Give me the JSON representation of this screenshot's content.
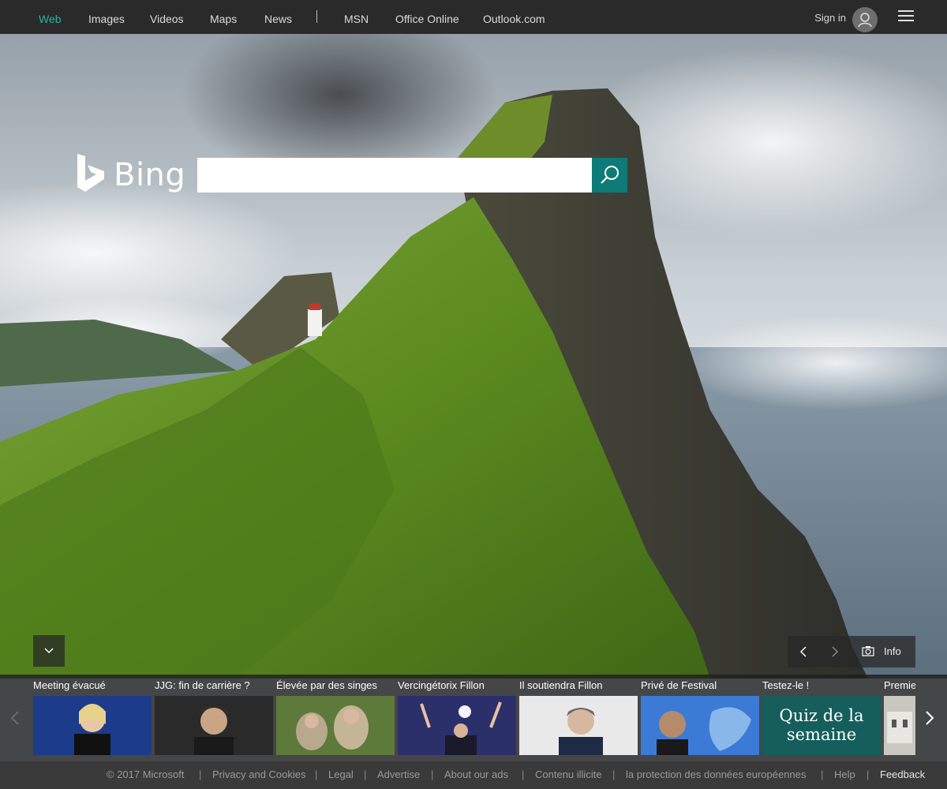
{
  "nav": {
    "items": [
      {
        "label": "Web",
        "active": true
      },
      {
        "label": "Images"
      },
      {
        "label": "Videos"
      },
      {
        "label": "Maps"
      },
      {
        "label": "News"
      },
      {
        "label": "MSN"
      },
      {
        "label": "Office Online"
      },
      {
        "label": "Outlook.com"
      }
    ],
    "sign_in": "Sign in",
    "avatar_icon": "user-icon",
    "menu_icon": "hamburger-icon"
  },
  "logo": {
    "text": "Bing",
    "icon": "bing-logo-icon"
  },
  "search": {
    "value": "",
    "placeholder": "",
    "button_icon": "search-icon"
  },
  "controls": {
    "collapse_icon": "chevron-down-icon",
    "prev_icon": "chevron-left-icon",
    "next_icon": "chevron-right-icon",
    "camera_icon": "camera-icon",
    "info_label": "Info"
  },
  "news": {
    "left_icon": "chevron-left-icon",
    "right_icon": "chevron-right-icon",
    "tiles": [
      {
        "caption": "Meeting évacué"
      },
      {
        "caption": "JJG: fin de carrière ?"
      },
      {
        "caption": "Élevée par des singes"
      },
      {
        "caption": "Vercingétorix Fillon"
      },
      {
        "caption": "Il soutiendra Fillon"
      },
      {
        "caption": "Privé de Festival"
      },
      {
        "caption": "Testez-le !",
        "quiz_line1": "Quiz de la",
        "quiz_line2": "semaine"
      },
      {
        "caption": "Premie"
      }
    ]
  },
  "footer": {
    "copyright": "© 2017 Microsoft",
    "links": [
      "Privacy and Cookies",
      "Legal",
      "Advertise",
      "About our ads",
      "Contenu illicite",
      "la protection des données européennes",
      "Help"
    ],
    "feedback": "Feedback"
  },
  "colors": {
    "accent": "#0e7b78",
    "nav_active": "#2bb1a6",
    "nav_bg": "#2a2a2a"
  }
}
